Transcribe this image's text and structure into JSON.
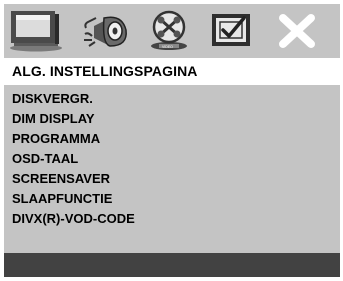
{
  "tabs": [
    {
      "icon": "general-setup-icon"
    },
    {
      "icon": "audio-setup-icon"
    },
    {
      "icon": "video-setup-icon"
    },
    {
      "icon": "preference-setup-icon"
    },
    {
      "icon": "close-icon"
    }
  ],
  "header": {
    "title": "ALG. INSTELLINGSPAGINA"
  },
  "menu": {
    "items": [
      {
        "label": "DISKVERGR."
      },
      {
        "label": "DIM DISPLAY"
      },
      {
        "label": "PROGRAMMA"
      },
      {
        "label": "OSD-TAAL"
      },
      {
        "label": "SCREENSAVER"
      },
      {
        "label": "SLAAPFUNCTIE"
      },
      {
        "label": "DIVX(R)-VOD-CODE"
      }
    ]
  },
  "colors": {
    "panel": "#c4c4c4",
    "header_bg": "#ffffff",
    "footer_bg": "#424242",
    "text": "#000000"
  }
}
